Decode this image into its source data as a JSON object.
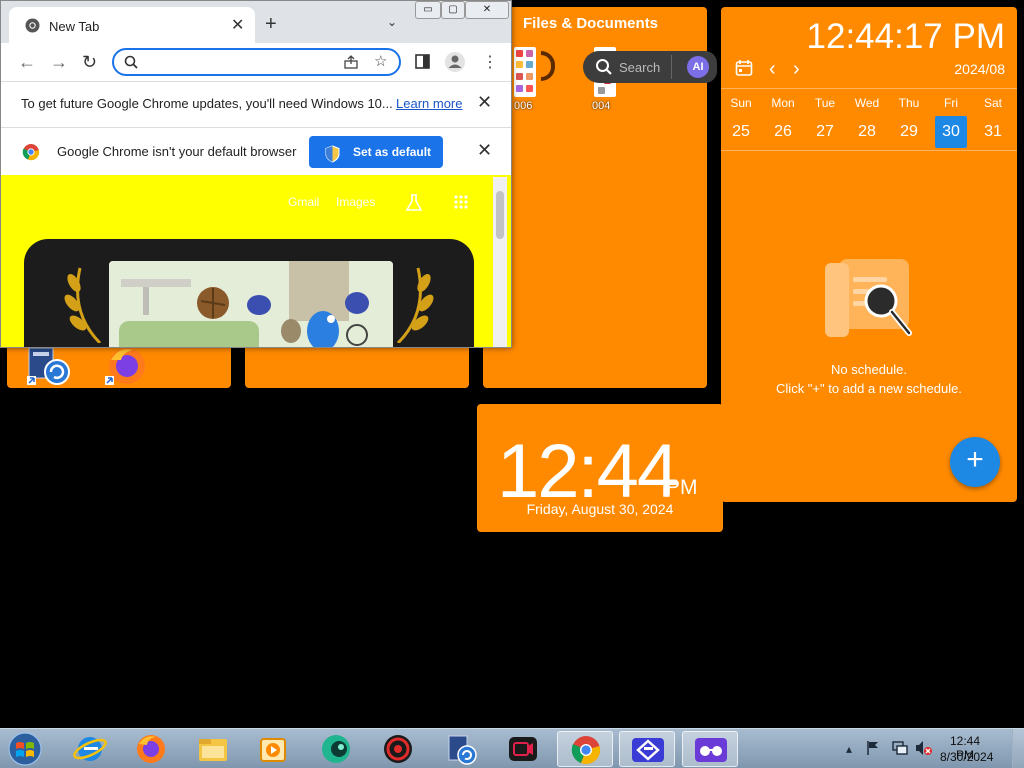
{
  "desktop": {
    "files_widget": {
      "title": "Files & Documents",
      "items": [
        "006",
        "004"
      ],
      "search_placeholder": "Search",
      "ai_label": "AI"
    },
    "clock_widget": {
      "time": "12:44",
      "ampm": "PM",
      "date": "Friday, August 30, 2024"
    },
    "calendar_widget": {
      "time": "12:44:17 PM",
      "month": "2024/08",
      "weekdays": [
        "Sun",
        "Mon",
        "Tue",
        "Wed",
        "Thu",
        "Fri",
        "Sat"
      ],
      "days": [
        "25",
        "26",
        "27",
        "28",
        "29",
        "30",
        "31"
      ],
      "selected_day": "30",
      "empty_title": "No schedule.",
      "empty_hint": "Click \"+\" to add a new schedule.",
      "add_label": "+"
    },
    "desktop_icons": [
      "backup-restore-icon",
      "firefox-icon"
    ]
  },
  "chrome": {
    "tab_title": "New Tab",
    "tab_close": "✕",
    "new_tab": "+",
    "tab_menu": "⌄",
    "window_buttons": [
      "▭",
      "▢",
      "✕"
    ],
    "update_bar": {
      "text": "To get future Google Chrome updates, you'll need Windows 10...",
      "link": "Learn more",
      "close": "✕"
    },
    "default_bar": {
      "text": "Google Chrome isn't your default browser",
      "button": "Set as default",
      "close": "✕"
    },
    "newtab_links": [
      "Gmail",
      "Images"
    ],
    "colors": {
      "accent": "#1a73e8",
      "page_background": "#ffff00"
    }
  },
  "taskbar": {
    "time": "12:44 PM",
    "date": "8/30/2024",
    "pinned": [
      "internet-explorer-icon",
      "firefox-icon",
      "file-explorer-icon",
      "media-player-icon",
      "teal-app-icon",
      "red-app-icon",
      "backup-app-icon",
      "screen-recorder-icon",
      "chrome-icon",
      "frame-app-icon",
      "glasses-app-icon"
    ],
    "active": "chrome-icon"
  },
  "colors": {
    "widget": "#ff8a00",
    "accent": "#1e88e5",
    "desktop": "#000000"
  }
}
